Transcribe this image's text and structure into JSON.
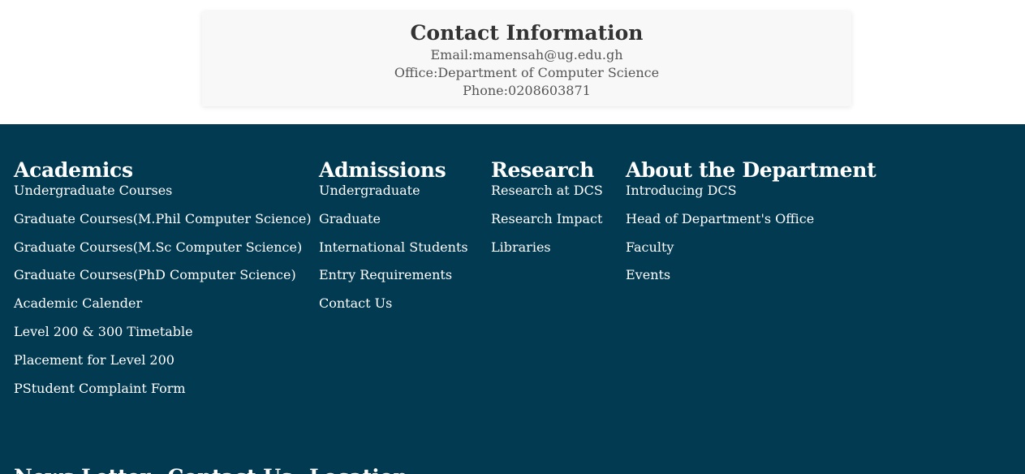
{
  "contact": {
    "title": "Contact Information",
    "email": "Email:mamensah@ug.edu.gh",
    "office": "Office:Department of Computer Science",
    "phone": "Phone:0208603871"
  },
  "footer": {
    "background_color": "#023a52",
    "columns": [
      {
        "heading": "Academics",
        "links": [
          "Undergraduate Courses",
          "Graduate Courses(M.Phil Computer Science)",
          "Graduate Courses(M.Sc Computer Science)",
          "Graduate Courses(PhD Computer Science)",
          "Academic Calender",
          "Level 200 & 300 Timetable",
          "Placement for Level 200",
          "PStudent Complaint Form"
        ]
      },
      {
        "heading": "Admissions",
        "links": [
          "Undergraduate",
          "Graduate",
          "International Students",
          "Entry Requirements",
          "Contact Us"
        ]
      },
      {
        "heading": "Research",
        "links": [
          "Research at DCS",
          "Research Impact",
          "Libraries"
        ]
      },
      {
        "heading": "About the Department",
        "links": [
          "Introducing DCS",
          "Head of Department's Office",
          "Faculty",
          "Events"
        ]
      }
    ],
    "bottom_headings": [
      "News Letter",
      "Contact Us",
      "Location"
    ]
  }
}
